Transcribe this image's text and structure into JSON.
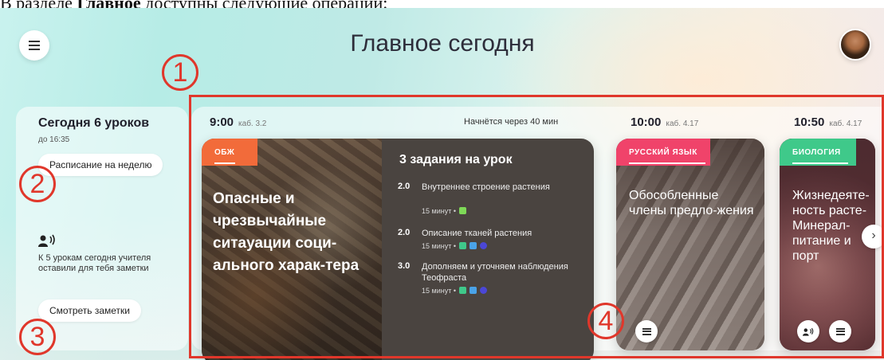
{
  "document_line": {
    "prefix": "В разделе ",
    "bold": "Главное",
    "suffix": " доступны следующие операции:"
  },
  "header": {
    "title": "Главное сегодня"
  },
  "sidebar": {
    "today_title": "Сегодня 6 уроков",
    "today_until": "до 16:35",
    "week_button": "Расписание на неделю",
    "notes_text": "К 5 урокам сегодня учителя оставили для тебя заметки",
    "notes_button": "Смотреть заметки"
  },
  "schedule": {
    "current": {
      "time": "9:00",
      "room": "каб. 3.2",
      "starts_in": "Начнётся через 40 мин",
      "subject": "ОБЖ",
      "subject_color": "#f26b3a",
      "lesson_title": "Опасные и чрезвычайные ситауации соци-ального харак-тера",
      "tasks_heading": "3 задания на урок",
      "tasks": [
        {
          "score": "2.0",
          "name": "Внутреннее строение растения",
          "meta": "15 минут •",
          "icons": [
            "wrench-icon"
          ]
        },
        {
          "score": "2.0",
          "name": "Описание тканей растения",
          "meta": "15 минут •",
          "icons": [
            "search-icon",
            "cloud-icon",
            "globe-icon"
          ]
        },
        {
          "score": "3.0",
          "name": "Дополняем и уточняем наблюдения Теофраста",
          "meta": "15 минут •",
          "icons": [
            "search-icon",
            "cloud-icon",
            "globe-icon"
          ]
        }
      ]
    },
    "next": [
      {
        "time": "10:00",
        "room": "каб. 4.17",
        "subject": "РУССКИЙ ЯЗЫК",
        "subject_color": "#f0436a",
        "lesson_title": "Обособленные члены предло-жения"
      },
      {
        "time": "10:50",
        "room": "каб. 4.17",
        "subject": "БИОЛОГИЯ",
        "subject_color": "#3fc98a",
        "lesson_title": "Жизнедеяте-ность расте-Минерал-питание и порт"
      }
    ]
  },
  "annotations": {
    "marker_1": "1",
    "marker_2": "2",
    "marker_3": "3",
    "marker_4": "4",
    "accent": "#e0372b"
  },
  "icons": {
    "menu": "menu-icon",
    "avatar": "avatar",
    "next": "chevron-right-icon",
    "list": "list-icon",
    "notes": "notes-icon"
  }
}
